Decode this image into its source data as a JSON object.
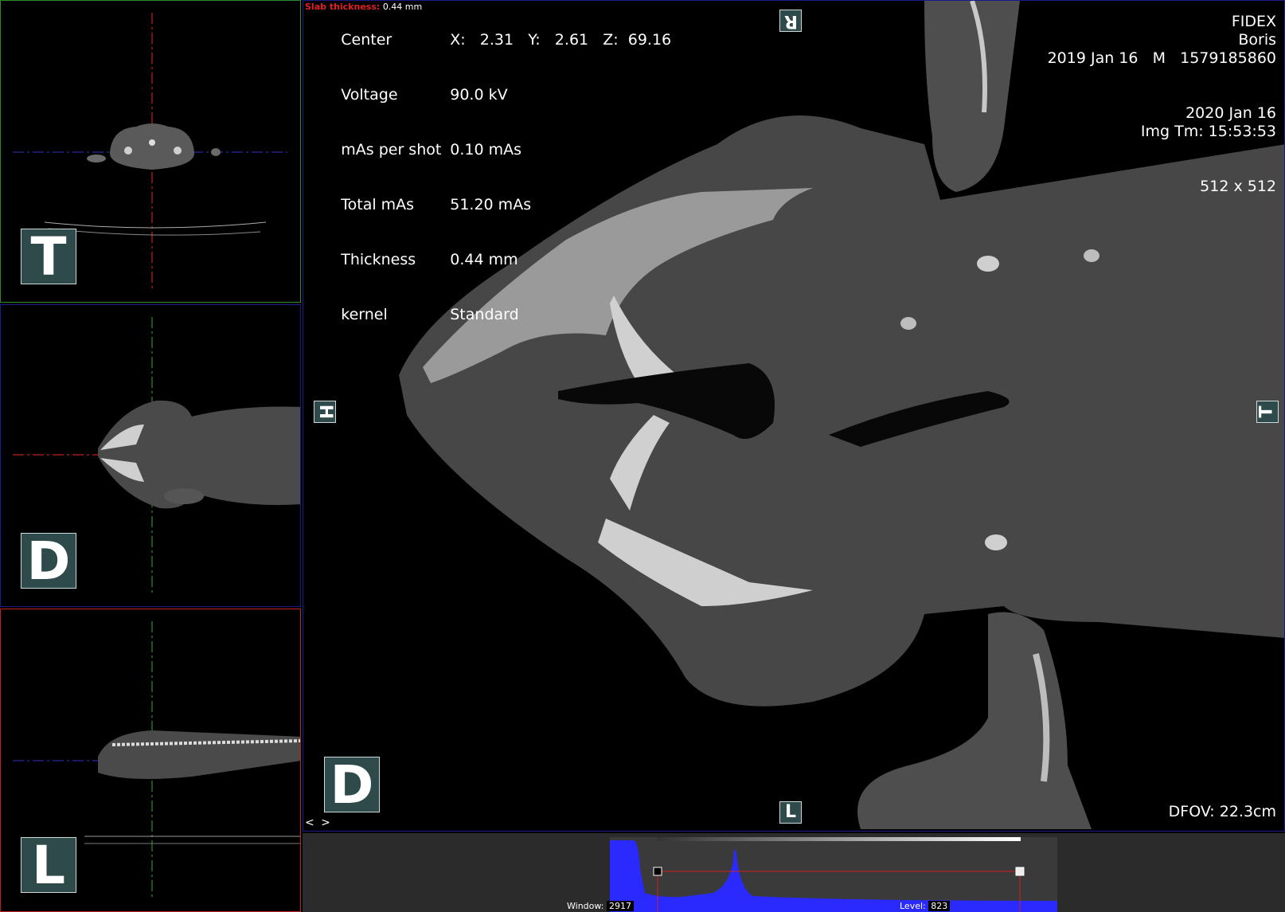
{
  "slab": {
    "label": "Slab thickness:",
    "value": "0.44 mm"
  },
  "acquisition": [
    {
      "label": "Center",
      "value": "X:   2.31   Y:   2.61   Z:  69.16"
    },
    {
      "label": "Voltage",
      "value": "90.0 kV"
    },
    {
      "label": "mAs per shot",
      "value": "0.10 mAs"
    },
    {
      "label": "Total mAs",
      "value": "51.20 mAs"
    },
    {
      "label": "Thickness",
      "value": "0.44 mm"
    },
    {
      "label": "kernel",
      "value": "Standard"
    }
  ],
  "patient": {
    "institution": "FIDEX",
    "name": "Boris",
    "dob_sex_id": "2019 Jan 16   M   1579185860",
    "study_date": "2020 Jan 16",
    "image_time": "Img Tm: 15:53:53",
    "matrix": "512 x 512",
    "dfov": "DFOV: 22.3cm"
  },
  "orientation": {
    "thumb_top": "T",
    "thumb_mid": "D",
    "thumb_bottom": "L",
    "main_view": "D",
    "top_marker": "R",
    "bottom_marker": "L",
    "left_marker": "H",
    "right_marker": "T"
  },
  "nav_arrows": "< >",
  "histogram": {
    "window_label": "Window:",
    "window_value": "2917",
    "level_label": "Level:",
    "level_value": "823"
  },
  "colors": {
    "thumb_top_border": "#2e8b2e",
    "thumb_mid_border": "#1a1a8a",
    "thumb_bottom_border": "#c02020",
    "slab_label": "#e02020",
    "histogram_fill": "#2a2aff"
  }
}
